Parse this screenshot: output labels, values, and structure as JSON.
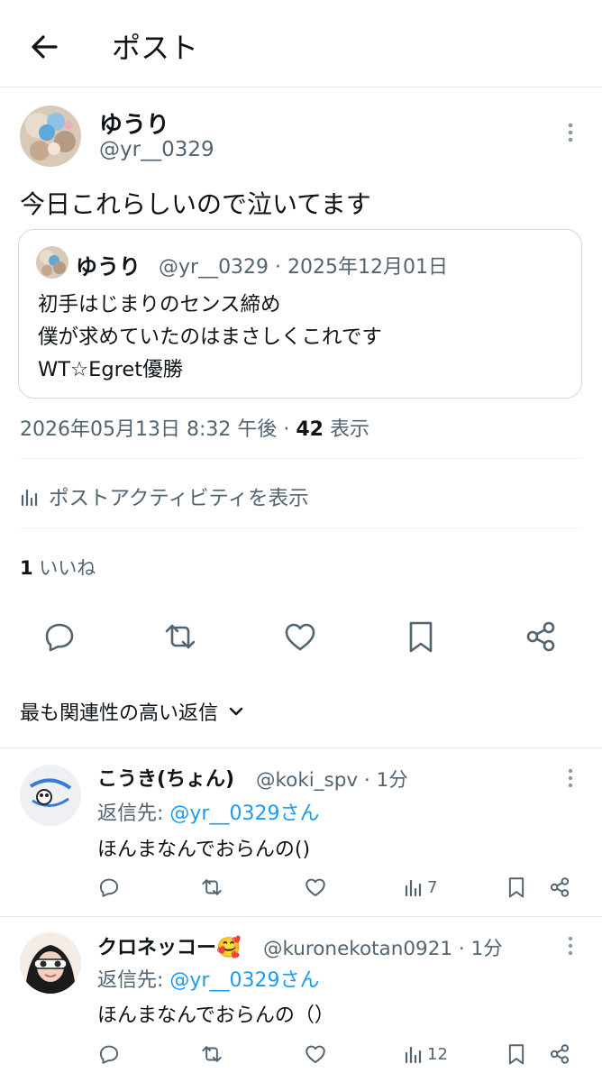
{
  "header": {
    "title": "ポスト"
  },
  "post": {
    "author_name": "ゆうり",
    "author_handle": "@yr__0329",
    "text": "今日これらしいので泣いてます",
    "quote": {
      "author_name": "ゆうり",
      "meta": "@yr__0329 · 2025年12月01日",
      "lines": [
        "初手はじまりのセンス締め",
        "僕が求めていたのはまさしくこれです",
        "WT☆Egret優勝"
      ]
    },
    "timestamp": "2026年05月13日 8:32 午後 · ",
    "views_count": "42",
    "views_label": " 表示",
    "activity_label": "ポストアクティビティを表示",
    "likes_count": "1",
    "likes_label": " いいね"
  },
  "sort_label": "最も関連性の高い返信",
  "replies": [
    {
      "name": "こうき(ちょん)",
      "meta": "@koki_spv · 1分",
      "reply_prefix": "返信先: ",
      "reply_to": "@yr__0329さん",
      "text": "ほんまなんでおらんの()",
      "views": "7"
    },
    {
      "name": "クロネッコー🥰",
      "meta": "@kuronekotan0921 · 1分",
      "reply_prefix": "返信先: ",
      "reply_to": "@yr__0329さん",
      "text": "ほんまなんでおらんの（）",
      "views": "12"
    }
  ],
  "colors": {
    "accent": "#1d9bf0",
    "muted": "#536471",
    "text": "#0f1419",
    "border": "#cfd9de"
  },
  "icons": [
    "arrow-left-icon",
    "more-vertical-icon",
    "bar-chart-icon",
    "reply-icon",
    "repost-icon",
    "like-icon",
    "bookmark-icon",
    "share-icon",
    "chevron-down-icon"
  ]
}
